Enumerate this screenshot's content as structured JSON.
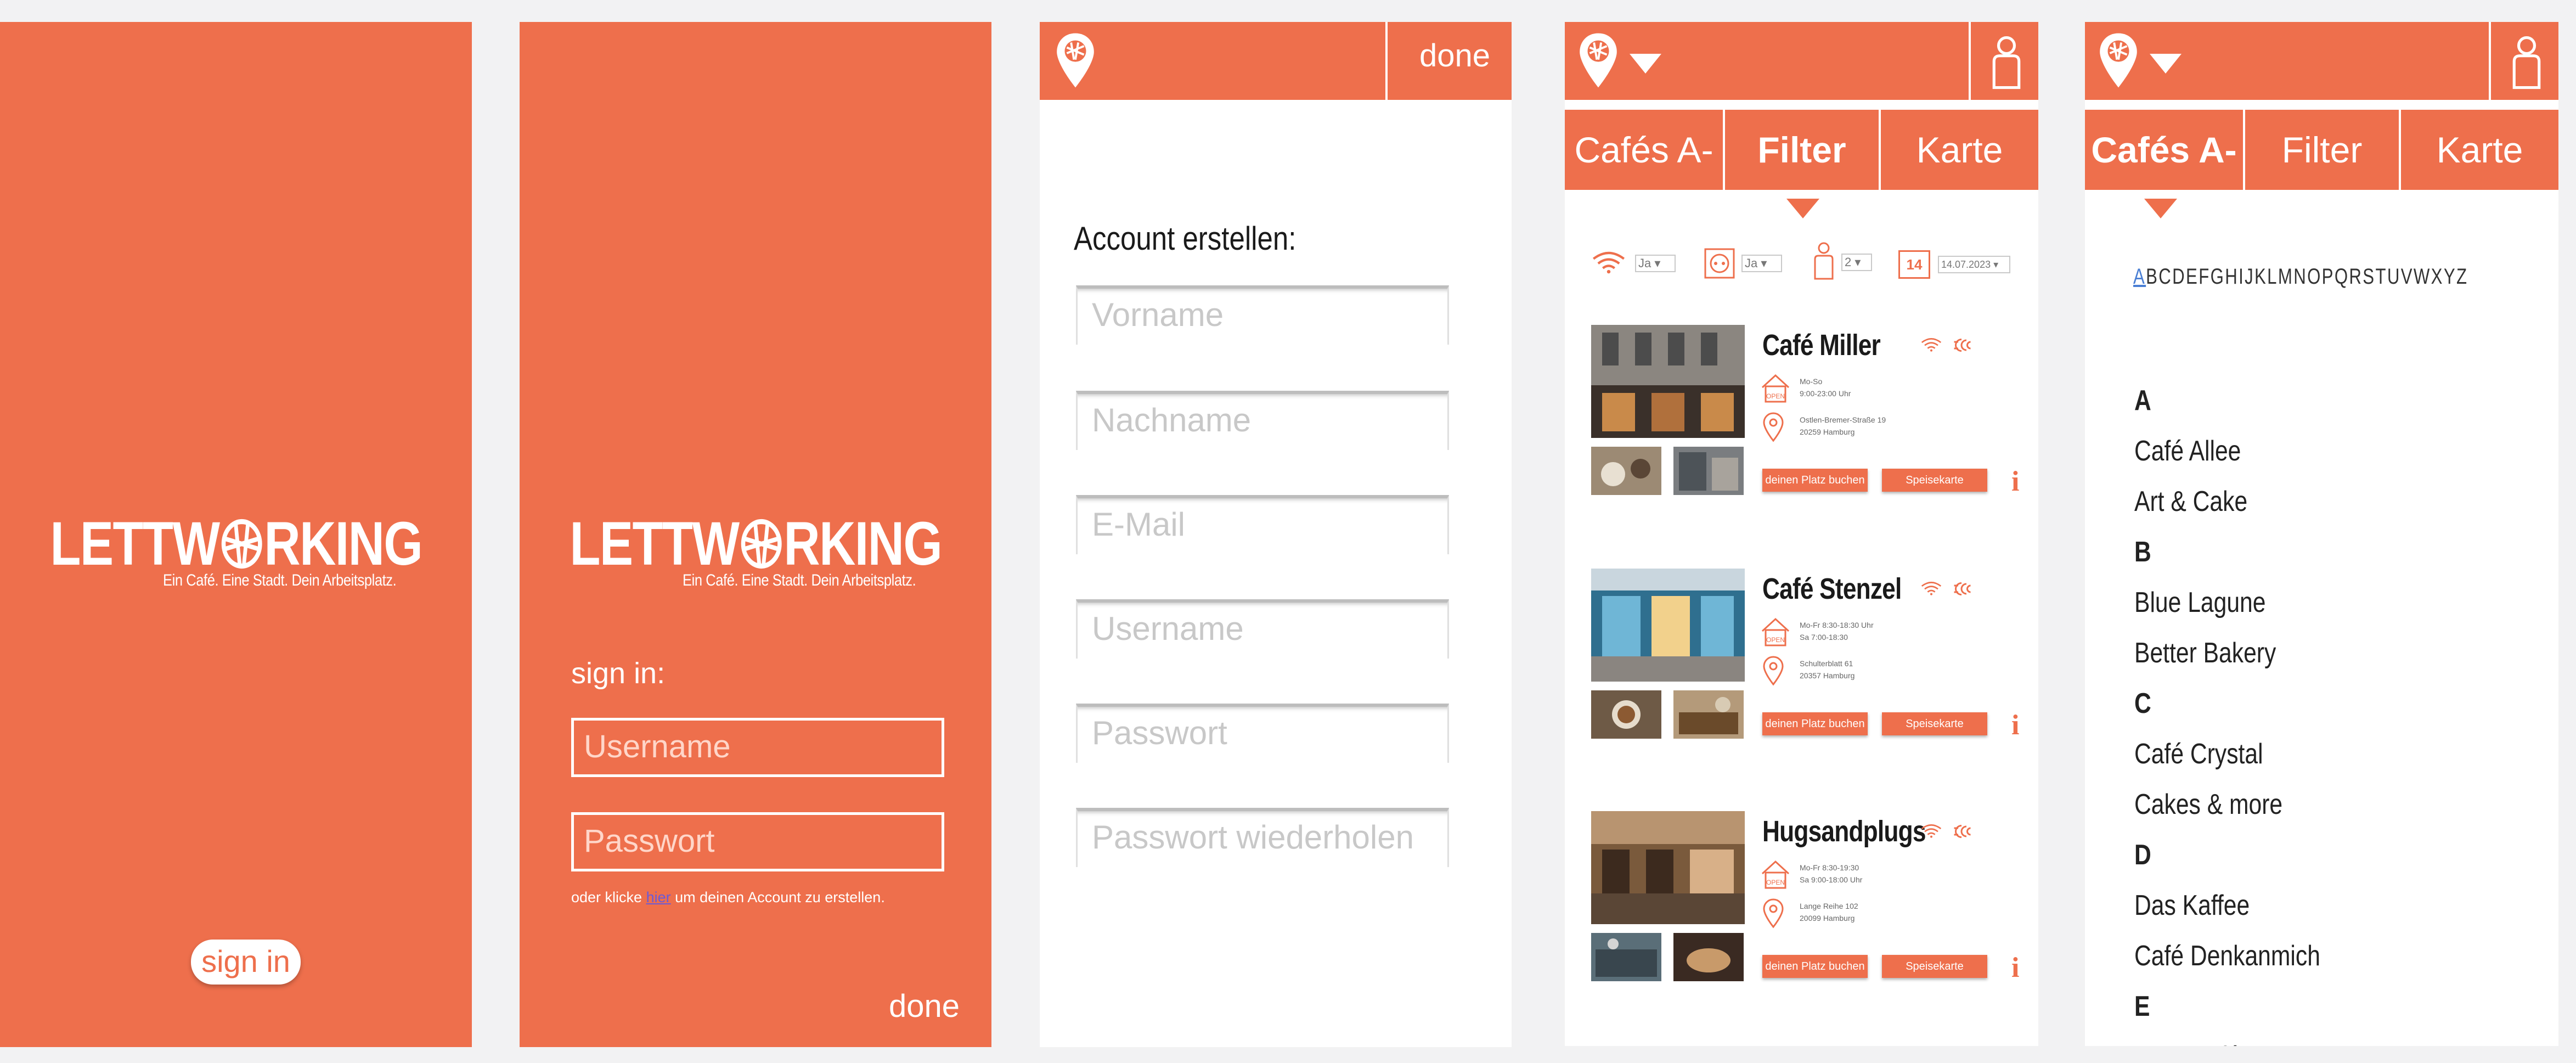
{
  "app": {
    "logo_left": "LETTW",
    "logo_right": "RKING",
    "tagline": "Ein Café. Eine Stadt. Dein Arbeitsplatz."
  },
  "screen1": {
    "signin_button": "sign in"
  },
  "screen2": {
    "signin_label": "sign in:",
    "username_placeholder": "Username",
    "password_placeholder": "Passwort",
    "hint_prefix": "oder klicke ",
    "hint_link": "hier",
    "hint_suffix": " um deinen Account zu erstellen.",
    "done_label": "done"
  },
  "screen3": {
    "done_label": "done",
    "title": "Account erstellen:",
    "fields": [
      "Vorname",
      "Nachname",
      "E-Mail",
      "Username",
      "Passwort",
      "Passwort wiederholen"
    ]
  },
  "tabs": [
    "Cafés A-Z",
    "Filter",
    "Karte"
  ],
  "filter": {
    "wifi_value": "Ja",
    "socket_value": "Ja",
    "persons_value": "2",
    "calendar_day": "14",
    "date_value": "14.07.2023"
  },
  "cafes": [
    {
      "name": "Café Miller",
      "hours_1": "Mo-So",
      "hours_2": "9:00-23:00 Uhr",
      "open_badge": "OPEN",
      "address_1": "Ostlen-Bremer-Straße 19",
      "address_2": "20259 Hamburg",
      "book_label": "deinen Platz buchen",
      "menu_label": "Speisekarte"
    },
    {
      "name": "Café Stenzel",
      "hours_1": "Mo-Fr 8:30-18:30 Uhr",
      "hours_2": "Sa 7:00-18:30",
      "open_badge": "OPEN",
      "address_1": "Schulterblatt 61",
      "address_2": "20357 Hamburg",
      "book_label": "deinen Platz buchen",
      "menu_label": "Speisekarte"
    },
    {
      "name": "Hugsandplugs",
      "hours_1": "Mo-Fr 8:30-19:30",
      "hours_2": "Sa 9:00-18:00 Uhr",
      "open_badge": "OPEN",
      "address_1": "Lange Reihe 102",
      "address_2": "20099 Hamburg",
      "book_label": "deinen Platz buchen",
      "menu_label": "Speisekarte"
    }
  ],
  "az": {
    "alphabet_first": "A",
    "alphabet_rest": "BCDEFGHIJKLMNOPQRSTUVWXYZ",
    "entries": [
      {
        "text": "A",
        "kind": "letter"
      },
      {
        "text": "Café Allee",
        "kind": "cafe"
      },
      {
        "text": "Art & Cake",
        "kind": "cafe"
      },
      {
        "text": "B",
        "kind": "letter"
      },
      {
        "text": "Blue Lagune",
        "kind": "cafe"
      },
      {
        "text": "Better Bakery",
        "kind": "cafe"
      },
      {
        "text": "C",
        "kind": "letter"
      },
      {
        "text": "Café Crystal",
        "kind": "cafe"
      },
      {
        "text": "Cakes & more",
        "kind": "cafe"
      },
      {
        "text": "D",
        "kind": "letter"
      },
      {
        "text": "Das Kaffee",
        "kind": "cafe"
      },
      {
        "text": "Café Denkanmich",
        "kind": "cafe"
      },
      {
        "text": "E",
        "kind": "letter"
      },
      {
        "text": "Entencafé",
        "kind": "cafe"
      }
    ]
  },
  "colors": {
    "brand_orange": "#ee6f4c",
    "link_blue": "#4a7fd4"
  }
}
